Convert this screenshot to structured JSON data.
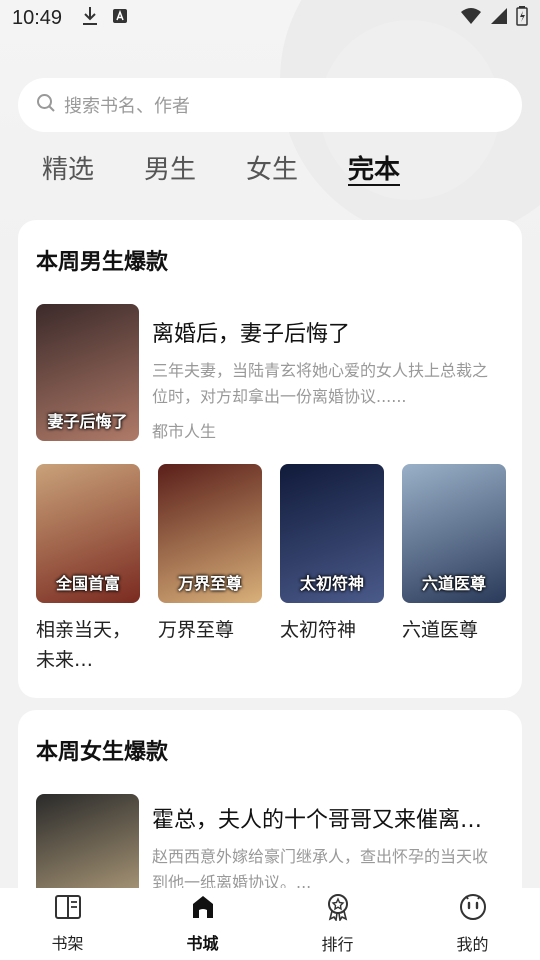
{
  "status_bar": {
    "time": "10:49"
  },
  "search": {
    "placeholder": "搜索书名、作者"
  },
  "tabs": [
    {
      "label": "精选",
      "active": false
    },
    {
      "label": "男生",
      "active": false
    },
    {
      "label": "女生",
      "active": false
    },
    {
      "label": "完本",
      "active": true
    }
  ],
  "section_male": {
    "title": "本周男生爆款",
    "featured": {
      "title": "离婚后，妻子后悔了",
      "description": "三年夫妻，当陆青玄将她心爱的女人扶上总裁之位时，对方却拿出一份离婚协议......",
      "category": "都市人生",
      "cover_text": "妻子后悔了",
      "cover_colors": [
        "#3b2a2a",
        "#b07a68"
      ]
    },
    "grid": [
      {
        "title": "相亲当天，未来…",
        "cover_text": "全国首富",
        "cover_colors": [
          "#c9a27a",
          "#7a2a20"
        ]
      },
      {
        "title": "万界至尊",
        "cover_text": "万界至尊",
        "cover_colors": [
          "#5a1f1a",
          "#d9b07a"
        ]
      },
      {
        "title": "太初符神",
        "cover_text": "太初符神",
        "cover_colors": [
          "#101a3a",
          "#4a5a8a"
        ]
      },
      {
        "title": "六道医尊",
        "cover_text": "六道医尊",
        "cover_colors": [
          "#9ab0c8",
          "#2a3a5a"
        ]
      }
    ]
  },
  "section_female": {
    "title": "本周女生爆款",
    "featured": {
      "title": "霍总，夫人的十个哥哥又来催离…",
      "description": "赵西西意外嫁给豪门继承人，查出怀孕的当天收到他一纸离婚协议。...",
      "cover_colors": [
        "#2a2a2a",
        "#c9b28a"
      ]
    }
  },
  "bottom_nav": [
    {
      "label": "书架",
      "icon": "bookshelf-icon",
      "active": false
    },
    {
      "label": "书城",
      "icon": "bookstore-icon",
      "active": true
    },
    {
      "label": "排行",
      "icon": "ranking-icon",
      "active": false
    },
    {
      "label": "我的",
      "icon": "profile-icon",
      "active": false
    }
  ]
}
